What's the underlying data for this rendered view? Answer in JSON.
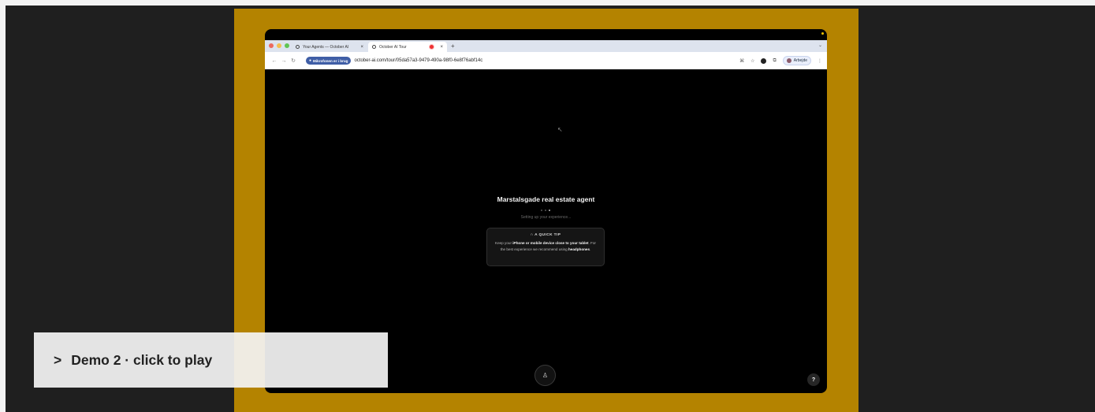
{
  "browser": {
    "tabs": [
      {
        "label": "Your Agents — October AI",
        "active": false
      },
      {
        "label": "October AI Tour",
        "active": true,
        "recording": true
      }
    ],
    "new_tab_icon": "plus-icon",
    "mic_pill": "Mikrofonen er i brug",
    "url": "october-ai.com/tour/05da57a3-9479-490a-98f0-6e8f76abf14c",
    "profile_name": "Arbejde"
  },
  "page": {
    "agent_title": "Marstalsgade real estate agent",
    "setup_text": "Setting up your experience...",
    "tip": {
      "heading": "A QUICK TIP",
      "line_prefix": "Keep your ",
      "line_bold1": "iPhone or mobile device close to your tablet",
      "line_mid": ". For the best experience we recommend using ",
      "line_bold2": "headphones",
      "line_suffix": "."
    },
    "help_label": "?"
  },
  "overlay": {
    "arrow": ">",
    "label": "Demo 2 · click to play"
  },
  "colors": {
    "frame": "#b48300",
    "page_bg": "#1f1f1f",
    "mic_pill": "#3f5ea6"
  }
}
